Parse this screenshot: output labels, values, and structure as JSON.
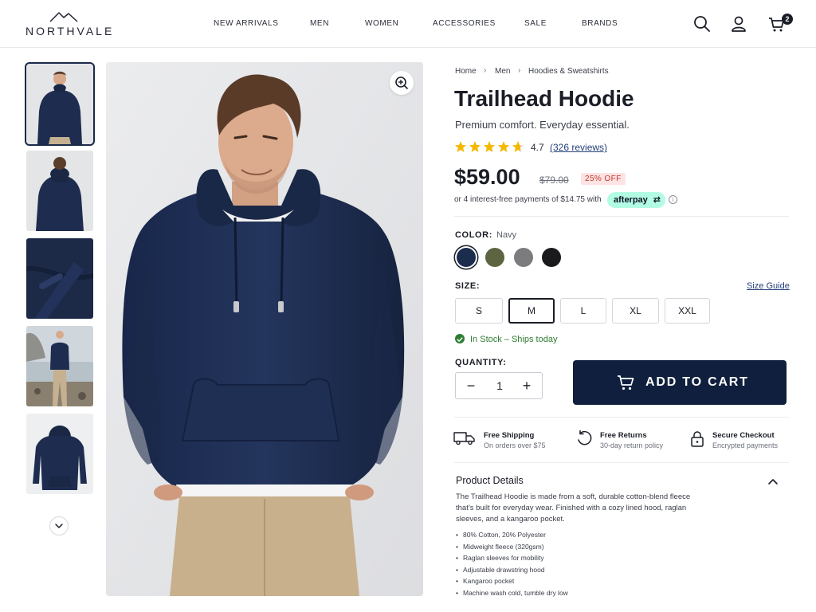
{
  "brand": {
    "name": "NORTHVALE"
  },
  "nav": {
    "items": [
      {
        "label": "NEW ARRIVALS"
      },
      {
        "label": "MEN"
      },
      {
        "label": "WOMEN"
      },
      {
        "label": "ACCESSORIES"
      },
      {
        "label": "SALE"
      },
      {
        "label": "BRANDS"
      }
    ],
    "icons": [
      "search-icon",
      "user-icon",
      "cart-icon"
    ],
    "cart_count": "2"
  },
  "gallery": {
    "thumbnails": [
      "front-view",
      "back-view",
      "fabric-detail",
      "outdoor-lifestyle",
      "flat-lay"
    ],
    "selected_index": 0,
    "more_icon": "chevron-down-icon",
    "zoom_icon": "zoom-in-icon"
  },
  "product": {
    "breadcrumb": [
      "Home",
      "Men",
      "Hoodies & Sweatshirts"
    ],
    "title": "Trailhead Hoodie",
    "subtitle": "Premium comfort. Everyday essential.",
    "rating": "4.7",
    "rating_value": 4.7,
    "rating_max": 5,
    "reviews_label": "(326 reviews)",
    "price": "$59.00",
    "original_price": "$79.00",
    "discount_badge": "25% OFF",
    "installments_text": "or 4 interest-free payments of $14.75 with",
    "afterpay_label": "afterpay",
    "color": {
      "label": "COLOR:",
      "selected_name": "Navy",
      "swatches": [
        {
          "name": "Navy",
          "hex": "#1c2c4c"
        },
        {
          "name": "Olive",
          "hex": "#5c6442"
        },
        {
          "name": "Grey",
          "hex": "#7c7c7e"
        },
        {
          "name": "Black",
          "hex": "#1a1a1c"
        }
      ]
    },
    "size": {
      "label": "SIZE:",
      "guide_label": "Size Guide",
      "options": [
        "S",
        "M",
        "L",
        "XL",
        "XXL"
      ],
      "selected": "M"
    },
    "stock_text": "In Stock – Ships today",
    "quantity": {
      "label": "QUANTITY:",
      "value": "1",
      "minus": "−",
      "plus": "+"
    },
    "add_to_cart_label": "ADD TO CART",
    "features": [
      {
        "title": "Free Shipping",
        "subtitle": "On orders over $75",
        "icon": "truck-icon"
      },
      {
        "title": "Free Returns",
        "subtitle": "30-day return policy",
        "icon": "return-icon"
      },
      {
        "title": "Secure Checkout",
        "subtitle": "Encrypted payments",
        "icon": "lock-icon"
      }
    ],
    "details": {
      "title": "Product Details",
      "description": "The Trailhead Hoodie is made from a soft, durable cotton-blend fleece that’s built for everyday wear. Finished with a cozy lined hood, raglan sleeves, and a kangaroo pocket.",
      "bullets": [
        "80% Cotton, 20% Polyester",
        "Midweight fleece (320gsm)",
        "Raglan sleeves for mobility",
        "Adjustable drawstring hood",
        "Kangaroo pocket",
        "Machine wash cold, tumble dry low"
      ]
    }
  },
  "colors": {
    "accent": "#0f1f3d",
    "star": "#f5b800",
    "in_stock": "#2e7d32",
    "discount_text": "#c0392b",
    "discount_bg": "#fde3e3",
    "afterpay_bg": "#b2fce4",
    "link": "#24407a"
  }
}
